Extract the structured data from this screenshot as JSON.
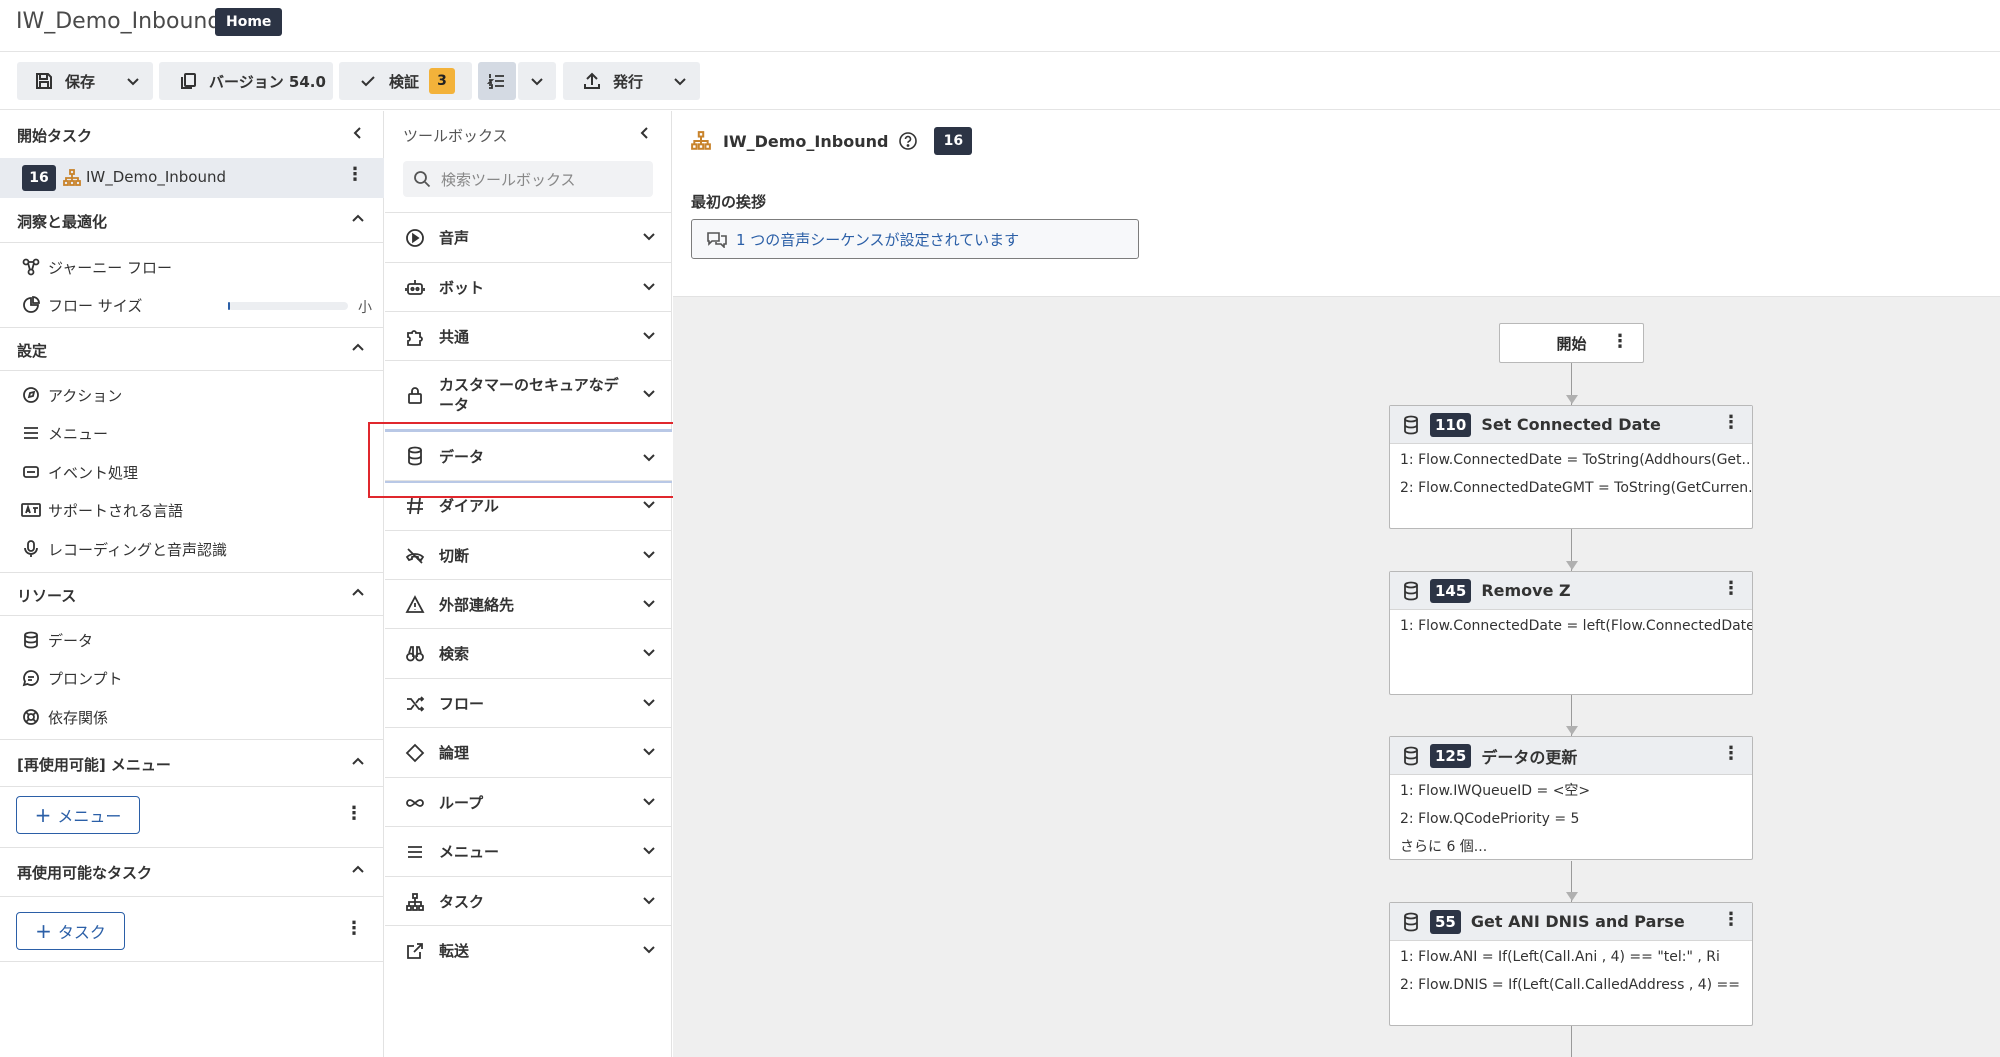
{
  "header": {
    "app_title": "IW_Demo_Inbound",
    "home_badge": "Home"
  },
  "toolbar": {
    "save": "保存",
    "version": "バージョン 54.0",
    "validate": "検証",
    "validate_count": "3",
    "publish": "発行"
  },
  "left": {
    "start_task": {
      "title": "開始タスク",
      "item_number": "16",
      "item_label": "IW_Demo_Inbound"
    },
    "insights": {
      "title": "洞察と最適化",
      "items": [
        "ジャーニー フロー",
        "フロー サイズ"
      ],
      "flow_size_value": "小",
      "flow_size_fraction": 0.02
    },
    "settings": {
      "title": "設定",
      "items": [
        "アクション",
        "メニュー",
        "イベント処理",
        "サポートされる言語",
        "レコーディングと音声認識"
      ]
    },
    "resources": {
      "title": "リソース",
      "items": [
        "データ",
        "プロンプト",
        "依存関係"
      ]
    },
    "reusable_menus": {
      "title": "[再使用可能] メニュー",
      "add_button": "メニュー"
    },
    "reusable_tasks": {
      "title": "再使用可能なタスク",
      "add_button": "タスク"
    }
  },
  "toolbox": {
    "title": "ツールボックス",
    "search_placeholder": "検索ツールボックス",
    "items": [
      "音声",
      "ボット",
      "共通",
      "カスタマーのセキュアなデータ",
      "データ",
      "ダイアル",
      "切断",
      "外部連絡先",
      "検索",
      "フロー",
      "論理",
      "ループ",
      "メニュー",
      "タスク",
      "転送"
    ]
  },
  "canvas": {
    "flow_name": "IW_Demo_Inbound",
    "flow_number": "16",
    "greeting_label": "最初の挨拶",
    "greeting_value": "1 つの音声シーケンスが設定されています",
    "start_label": "開始",
    "nodes": [
      {
        "number": "110",
        "title": "Set Connected Date",
        "lines": [
          "1: Flow.ConnectedDate = ToString(Addhours(Get...",
          "2: Flow.ConnectedDateGMT = ToString(GetCurren..."
        ]
      },
      {
        "number": "145",
        "title": "Remove Z",
        "lines": [
          "1: Flow.ConnectedDate = left(Flow.ConnectedDate..."
        ]
      },
      {
        "number": "125",
        "title": "データの更新",
        "lines": [
          "1: Flow.IWQueueID = <空>",
          "2: Flow.QCodePriority = 5",
          "さらに 6 個..."
        ]
      },
      {
        "number": "55",
        "title": "Get ANI DNIS and Parse",
        "lines": [
          "1: Flow.ANI = If(Left(Call.Ani , 4) == \"tel:\" , Ri",
          "2: Flow.DNIS = If(Left(Call.CalledAddress , 4) =="
        ]
      }
    ]
  },
  "colors": {
    "dark_badge": "#2c3445",
    "warning": "#f3b23a",
    "link_blue": "#2b5fa7",
    "highlight_red": "#e0272d",
    "canvas_bg": "#efefef"
  }
}
